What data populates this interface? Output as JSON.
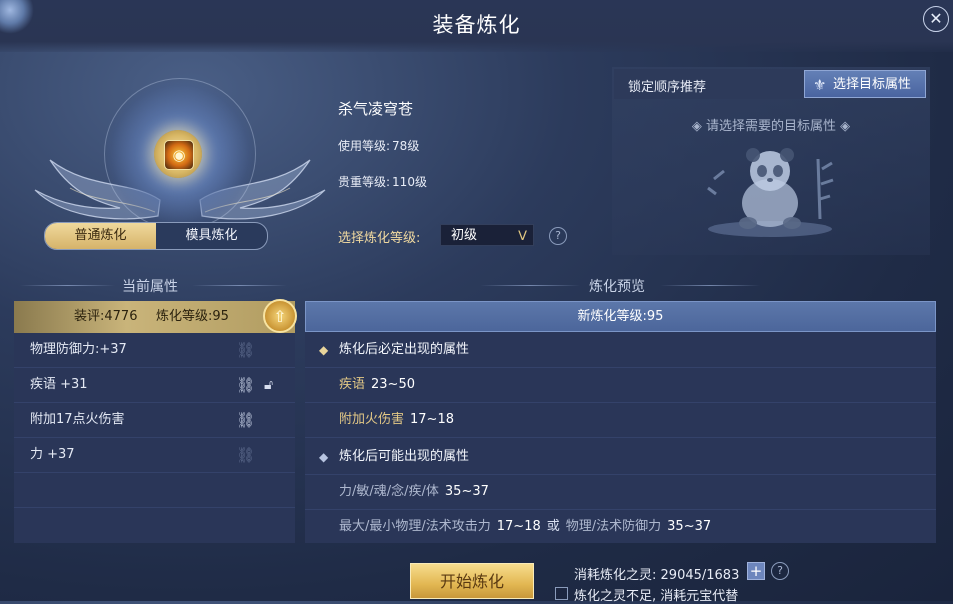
{
  "window": {
    "title": "装备炼化",
    "close_glyph": "✕"
  },
  "item": {
    "name": "杀气凌穹苍",
    "use_level_label": "使用等级:",
    "use_level": "78级",
    "rarity_level_label": "贵重等级:",
    "rarity_level": "110级"
  },
  "mode_tabs": [
    {
      "label": "普通炼化",
      "active": true
    },
    {
      "label": "模具炼化",
      "active": false
    }
  ],
  "refine_select": {
    "label": "选择炼化等级:",
    "value": "初级",
    "arrow_glyph": "ᐯ",
    "help_glyph": "?"
  },
  "target_panel": {
    "lock_label": "锁定顺序推荐",
    "target_button": "选择目标属性",
    "hint": "◈ 请选择需要的目标属性 ◈"
  },
  "current": {
    "heading": "当前属性",
    "score": "装评:4776",
    "refine_level": "炼化等级:95",
    "rows": [
      {
        "label": "物理防御力:+37",
        "linked": false,
        "lock": false
      },
      {
        "label": "疾语 +31",
        "linked": true,
        "lock": true
      },
      {
        "label": "附加17点火伤害",
        "linked": true,
        "lock": false
      },
      {
        "label": "力 +37",
        "linked": false,
        "lock": false
      }
    ]
  },
  "preview": {
    "heading": "炼化预览",
    "new_level": "新炼化等级:95",
    "must_heading": "炼化后必定出现的属性",
    "must_attrs": [
      {
        "name": "疾语",
        "range": "23~50"
      },
      {
        "name": "附加火伤害",
        "range": "17~18"
      }
    ],
    "maybe_heading": "炼化后可能出现的属性",
    "maybe_line1_name": "力/敏/魂/念/疾/体",
    "maybe_line1_range": "35~37",
    "maybe_line2_a": "最大/最小物理/法术攻击力",
    "maybe_line2_a_range": "17~18",
    "maybe_line2_or": "或",
    "maybe_line2_b": "物理/法术防御力",
    "maybe_line2_b_range": "35~37"
  },
  "footer": {
    "start_button": "开始炼化",
    "cost_label": "消耗炼化之灵:",
    "cost_value": "29045/1683",
    "plus_glyph": "+",
    "help_glyph": "?",
    "checkbox_label": "炼化之灵不足, 消耗元宝代替",
    "checkbox_checked": false
  },
  "colors": {
    "accent_gold": "#e2c886",
    "panel_bg": "#2a3658",
    "preview_header": "#5c77aa"
  }
}
